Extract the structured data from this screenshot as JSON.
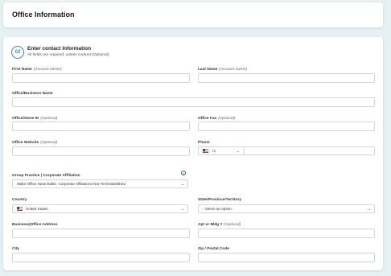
{
  "header": {
    "title": "Office Information"
  },
  "section": {
    "step": "02",
    "title": "Enter contact Information",
    "subtitle": "All fields are required, unless marked (Optional)."
  },
  "fields": {
    "first_name": {
      "label": "First Name",
      "hint": "(Account owner)"
    },
    "last_name": {
      "label": "Last Name",
      "hint": "(Account owner)"
    },
    "office_name": {
      "label": "Office/Business Name"
    },
    "office_store_id": {
      "label": "Office/Store ID",
      "hint": "(Optional)"
    },
    "office_fax": {
      "label": "Office Fax",
      "hint": "(Optional)"
    },
    "office_website": {
      "label": "Office Website",
      "hint": "(Optional)"
    },
    "phone": {
      "label": "Phone",
      "country_code": "+1",
      "country_icon": "us-flag-icon"
    },
    "group_practice": {
      "label": "Group Practice | Corporate Affiliation",
      "selected": "Make Office Searchable, Corporate Affiliations Not Yet Established"
    },
    "country": {
      "label": "Country",
      "selected": "United States",
      "country_icon": "us-flag-icon"
    },
    "state": {
      "label": "State/Province/Territory",
      "selected": "- Select an option -"
    },
    "address": {
      "label": "Business|Office Address"
    },
    "apt": {
      "label": "Apt or Bldg #",
      "hint": "(Optional)"
    },
    "city": {
      "label": "City"
    },
    "zip": {
      "label": "Zip / Postal Code"
    }
  },
  "icons": {
    "info": "i",
    "chevron": "⌄"
  },
  "colors": {
    "accent": "#3a82c4",
    "background": "#e6f1f4",
    "border": "#cfd6db"
  }
}
